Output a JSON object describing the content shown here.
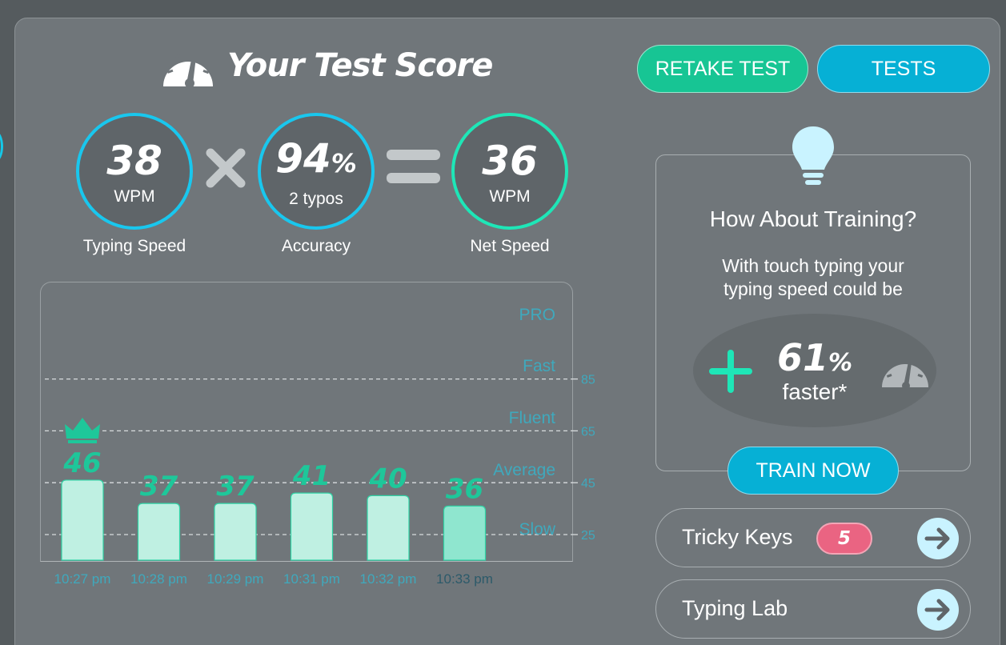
{
  "header": {
    "title": "Your Test Score",
    "retake_label": "RETAKE TEST",
    "tests_label": "TESTS"
  },
  "score": {
    "speed": {
      "value": "38",
      "unit": "WPM",
      "caption": "Typing Speed"
    },
    "accuracy": {
      "value": "94",
      "unit_symbol": "%",
      "sub": "2  typos",
      "caption": "Accuracy"
    },
    "net": {
      "value": "36",
      "unit": "WPM",
      "caption": "Net Speed"
    }
  },
  "chart_data": {
    "type": "bar",
    "categories": [
      "10:27 pm",
      "10:28 pm",
      "10:29 pm",
      "10:31 pm",
      "10:32 pm",
      "10:33 pm"
    ],
    "values": [
      46,
      37,
      37,
      41,
      40,
      36
    ],
    "best_index": 0,
    "current_index": 5,
    "ylim": [
      0,
      100
    ],
    "reference_lines": [
      85,
      65,
      45,
      25
    ],
    "bands": [
      "PRO",
      "Fast",
      "Fluent",
      "Average",
      "Slow"
    ]
  },
  "training": {
    "title": "How About Training?",
    "subtitle": "With touch typing your typing speed could be",
    "percent": "61",
    "percent_symbol": "%",
    "faster_label": "faster*",
    "train_label": "TRAIN NOW"
  },
  "links": {
    "tricky_keys": {
      "label": "Tricky Keys",
      "badge": "5"
    },
    "typing_lab": {
      "label": "Typing Lab"
    }
  },
  "colors": {
    "accent_cyan": "#19c7ee",
    "accent_green": "#1ee6b7",
    "bar_fill": "#bff0e2",
    "bar_current": "#8fe6cf",
    "bar_label": "#1ec79a",
    "badge": "#ea6482"
  }
}
